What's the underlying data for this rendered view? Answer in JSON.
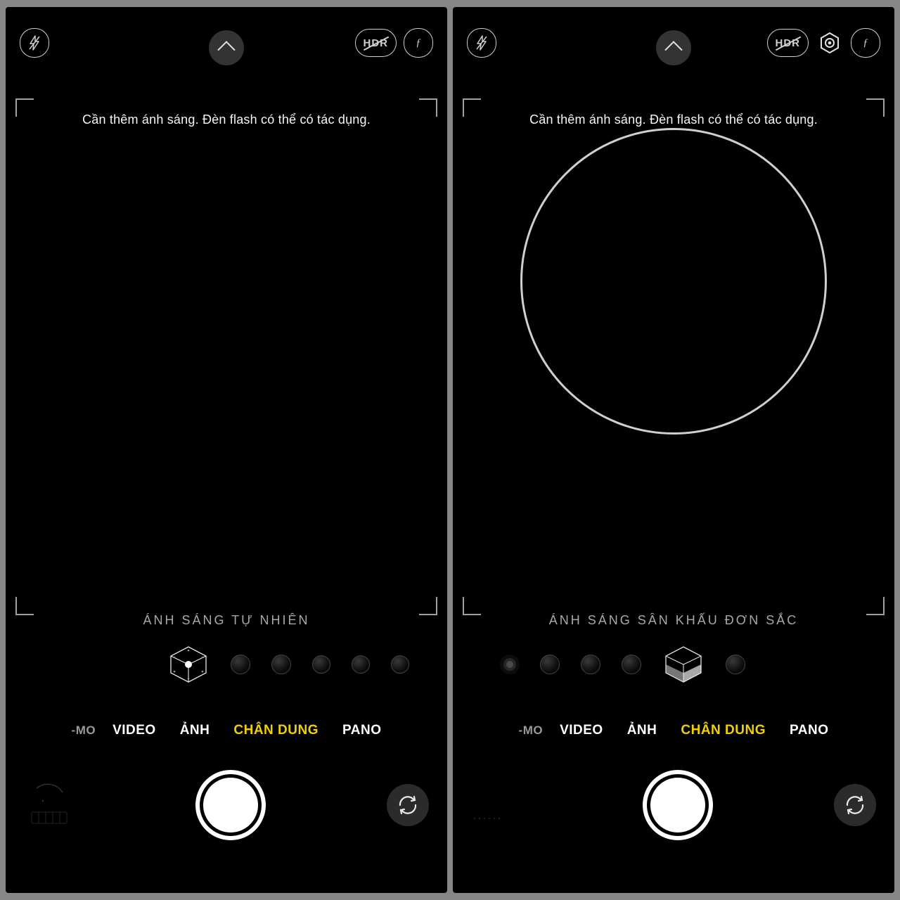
{
  "screens": {
    "left": {
      "status_message": "Cần thêm ánh sáng. Đèn flash có thể có tác dụng.",
      "light_label": "ÁNH SÁNG TỰ NHIÊN",
      "hdr": "HDR"
    },
    "right": {
      "status_message": "Cần thêm ánh sáng. Đèn flash có thể có tác dụng.",
      "light_label": "ÁNH SÁNG SÂN KHẤU ĐƠN SẮC",
      "hdr": "HDR"
    }
  },
  "modes": {
    "slomo_partial": "-MO",
    "video": "VIDEO",
    "photo": "ẢNH",
    "portrait": "CHÂN DUNG",
    "pano": "PANO"
  },
  "filters_glyph": "ƒ"
}
